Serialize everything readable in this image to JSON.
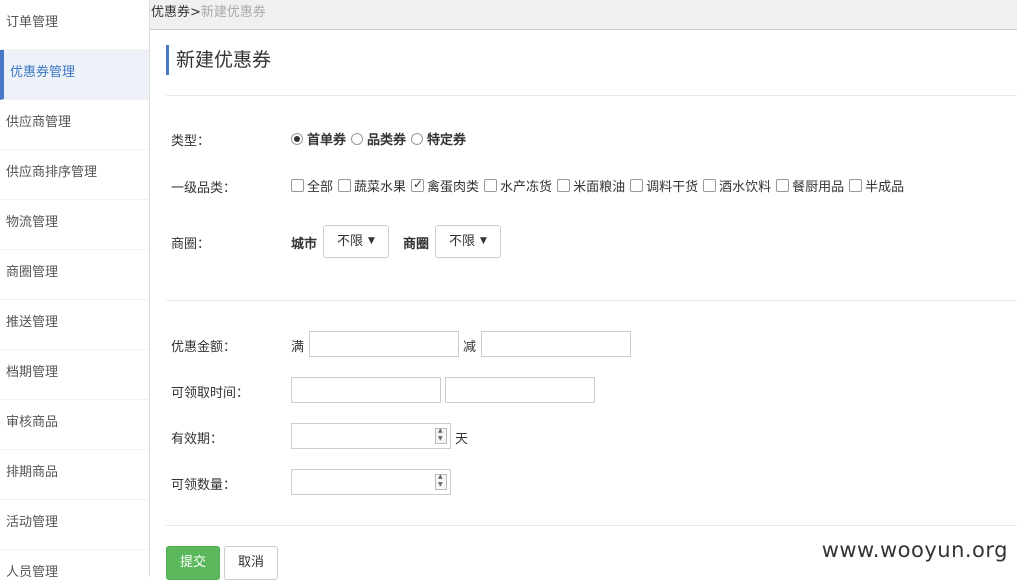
{
  "sidebar": {
    "items": [
      {
        "label": "订单管理"
      },
      {
        "label": "优惠券管理",
        "active": true
      },
      {
        "label": "供应商管理"
      },
      {
        "label": "供应商排序管理"
      },
      {
        "label": "物流管理"
      },
      {
        "label": "商圈管理"
      },
      {
        "label": "推送管理"
      },
      {
        "label": "档期管理"
      },
      {
        "label": "审核商品"
      },
      {
        "label": "排期商品"
      },
      {
        "label": "活动管理"
      },
      {
        "label": "人员管理"
      }
    ]
  },
  "breadcrumb": {
    "parent": "优惠券",
    "sep": ">",
    "current": "新建优惠券"
  },
  "page_title": "新建优惠券",
  "form": {
    "type_label": "类型：",
    "type_options": [
      {
        "label": "首单券",
        "checked": true
      },
      {
        "label": "品类券",
        "checked": false
      },
      {
        "label": "特定券",
        "checked": false
      }
    ],
    "category_label": "一级品类：",
    "category_options": [
      {
        "label": "全部",
        "checked": false
      },
      {
        "label": "蔬菜水果",
        "checked": false
      },
      {
        "label": "禽蛋肉类",
        "checked": true
      },
      {
        "label": "水产冻货",
        "checked": false
      },
      {
        "label": "米面粮油",
        "checked": false
      },
      {
        "label": "调料干货",
        "checked": false
      },
      {
        "label": "酒水饮料",
        "checked": false
      },
      {
        "label": "餐厨用品",
        "checked": false
      },
      {
        "label": "半成品",
        "checked": false
      }
    ],
    "area_label": "商圈：",
    "city_label": "城市",
    "city_value": "不限",
    "circle_label": "商圈",
    "circle_value": "不限",
    "amount_label": "优惠金额：",
    "full_label": "满",
    "minus_label": "减",
    "time_label": "可领取时间：",
    "validity_label": "有效期：",
    "day_unit": "天",
    "quantity_label": "可领数量：",
    "submit": "提交",
    "cancel": "取消"
  },
  "watermark": "www.wooyun.org",
  "colors": {
    "accent": "#4a78c8",
    "primary_button": "#5cb85c"
  }
}
